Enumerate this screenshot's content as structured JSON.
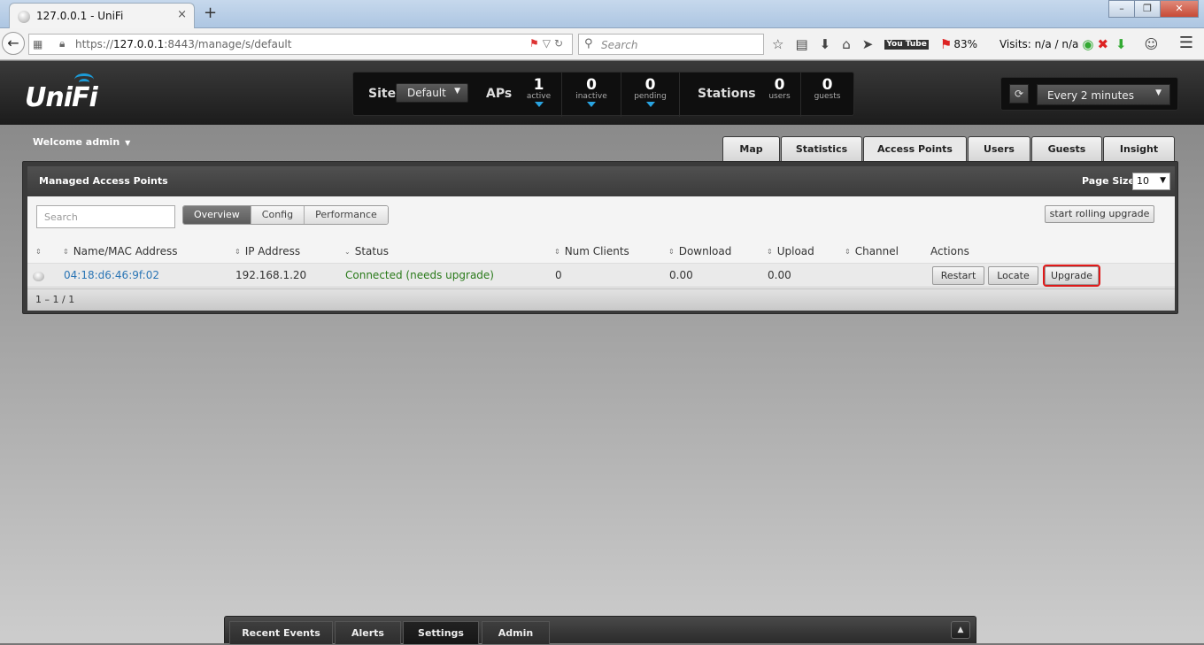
{
  "browser": {
    "tab_title": "127.0.0.1 - UniFi",
    "tab_close": "×",
    "new_tab": "+",
    "window_controls": [
      "–",
      "❐",
      "✕"
    ],
    "url_prefix": "https://",
    "url_host": "127.0.0.1",
    "url_rest": ":8443/manage/s/default",
    "search_placeholder": "Search",
    "battery": "83%",
    "visits": "Visits: n/a / n/a",
    "youtube": "You Tube"
  },
  "header": {
    "logo_text": "UniFi",
    "site_label": "Site",
    "site_value": "Default",
    "aps_label": "APs",
    "stations_label": "Stations",
    "stats": {
      "active": {
        "num": "1",
        "label": "active"
      },
      "inactive": {
        "num": "0",
        "label": "inactive"
      },
      "pending": {
        "num": "0",
        "label": "pending"
      },
      "users": {
        "num": "0",
        "label": "users"
      },
      "guests": {
        "num": "0",
        "label": "guests"
      }
    },
    "refresh_interval": "Every 2 minutes"
  },
  "welcome": "Welcome admin",
  "tabs": [
    "Map",
    "Statistics",
    "Access Points",
    "Users",
    "Guests",
    "Insight"
  ],
  "active_tab": "Access Points",
  "panel": {
    "title": "Managed Access Points",
    "page_size_label": "Page Size",
    "page_size_value": "10",
    "search_placeholder": "Search",
    "views": [
      "Overview",
      "Config",
      "Performance"
    ],
    "active_view": "Overview",
    "rolling_upgrade": "start rolling upgrade",
    "columns": [
      "Name/MAC Address",
      "IP Address",
      "Status",
      "Num Clients",
      "Download",
      "Upload",
      "Channel",
      "Actions"
    ],
    "rows": [
      {
        "name": "04:18:d6:46:9f:02",
        "ip": "192.168.1.20",
        "status": "Connected (needs upgrade)",
        "clients": "0",
        "download": "0.00",
        "upload": "0.00",
        "channel": "",
        "actions": [
          "Restart",
          "Locate",
          "Upgrade"
        ]
      }
    ],
    "pager": "1 – 1 / 1"
  },
  "bottom_tabs": [
    "Recent Events",
    "Alerts",
    "Settings",
    "Admin"
  ],
  "active_bottom_tab": "Settings",
  "colors": {
    "accent_blue": "#1c9ad6",
    "status_green": "#2a7a1a",
    "highlight_red": "#e01919"
  }
}
